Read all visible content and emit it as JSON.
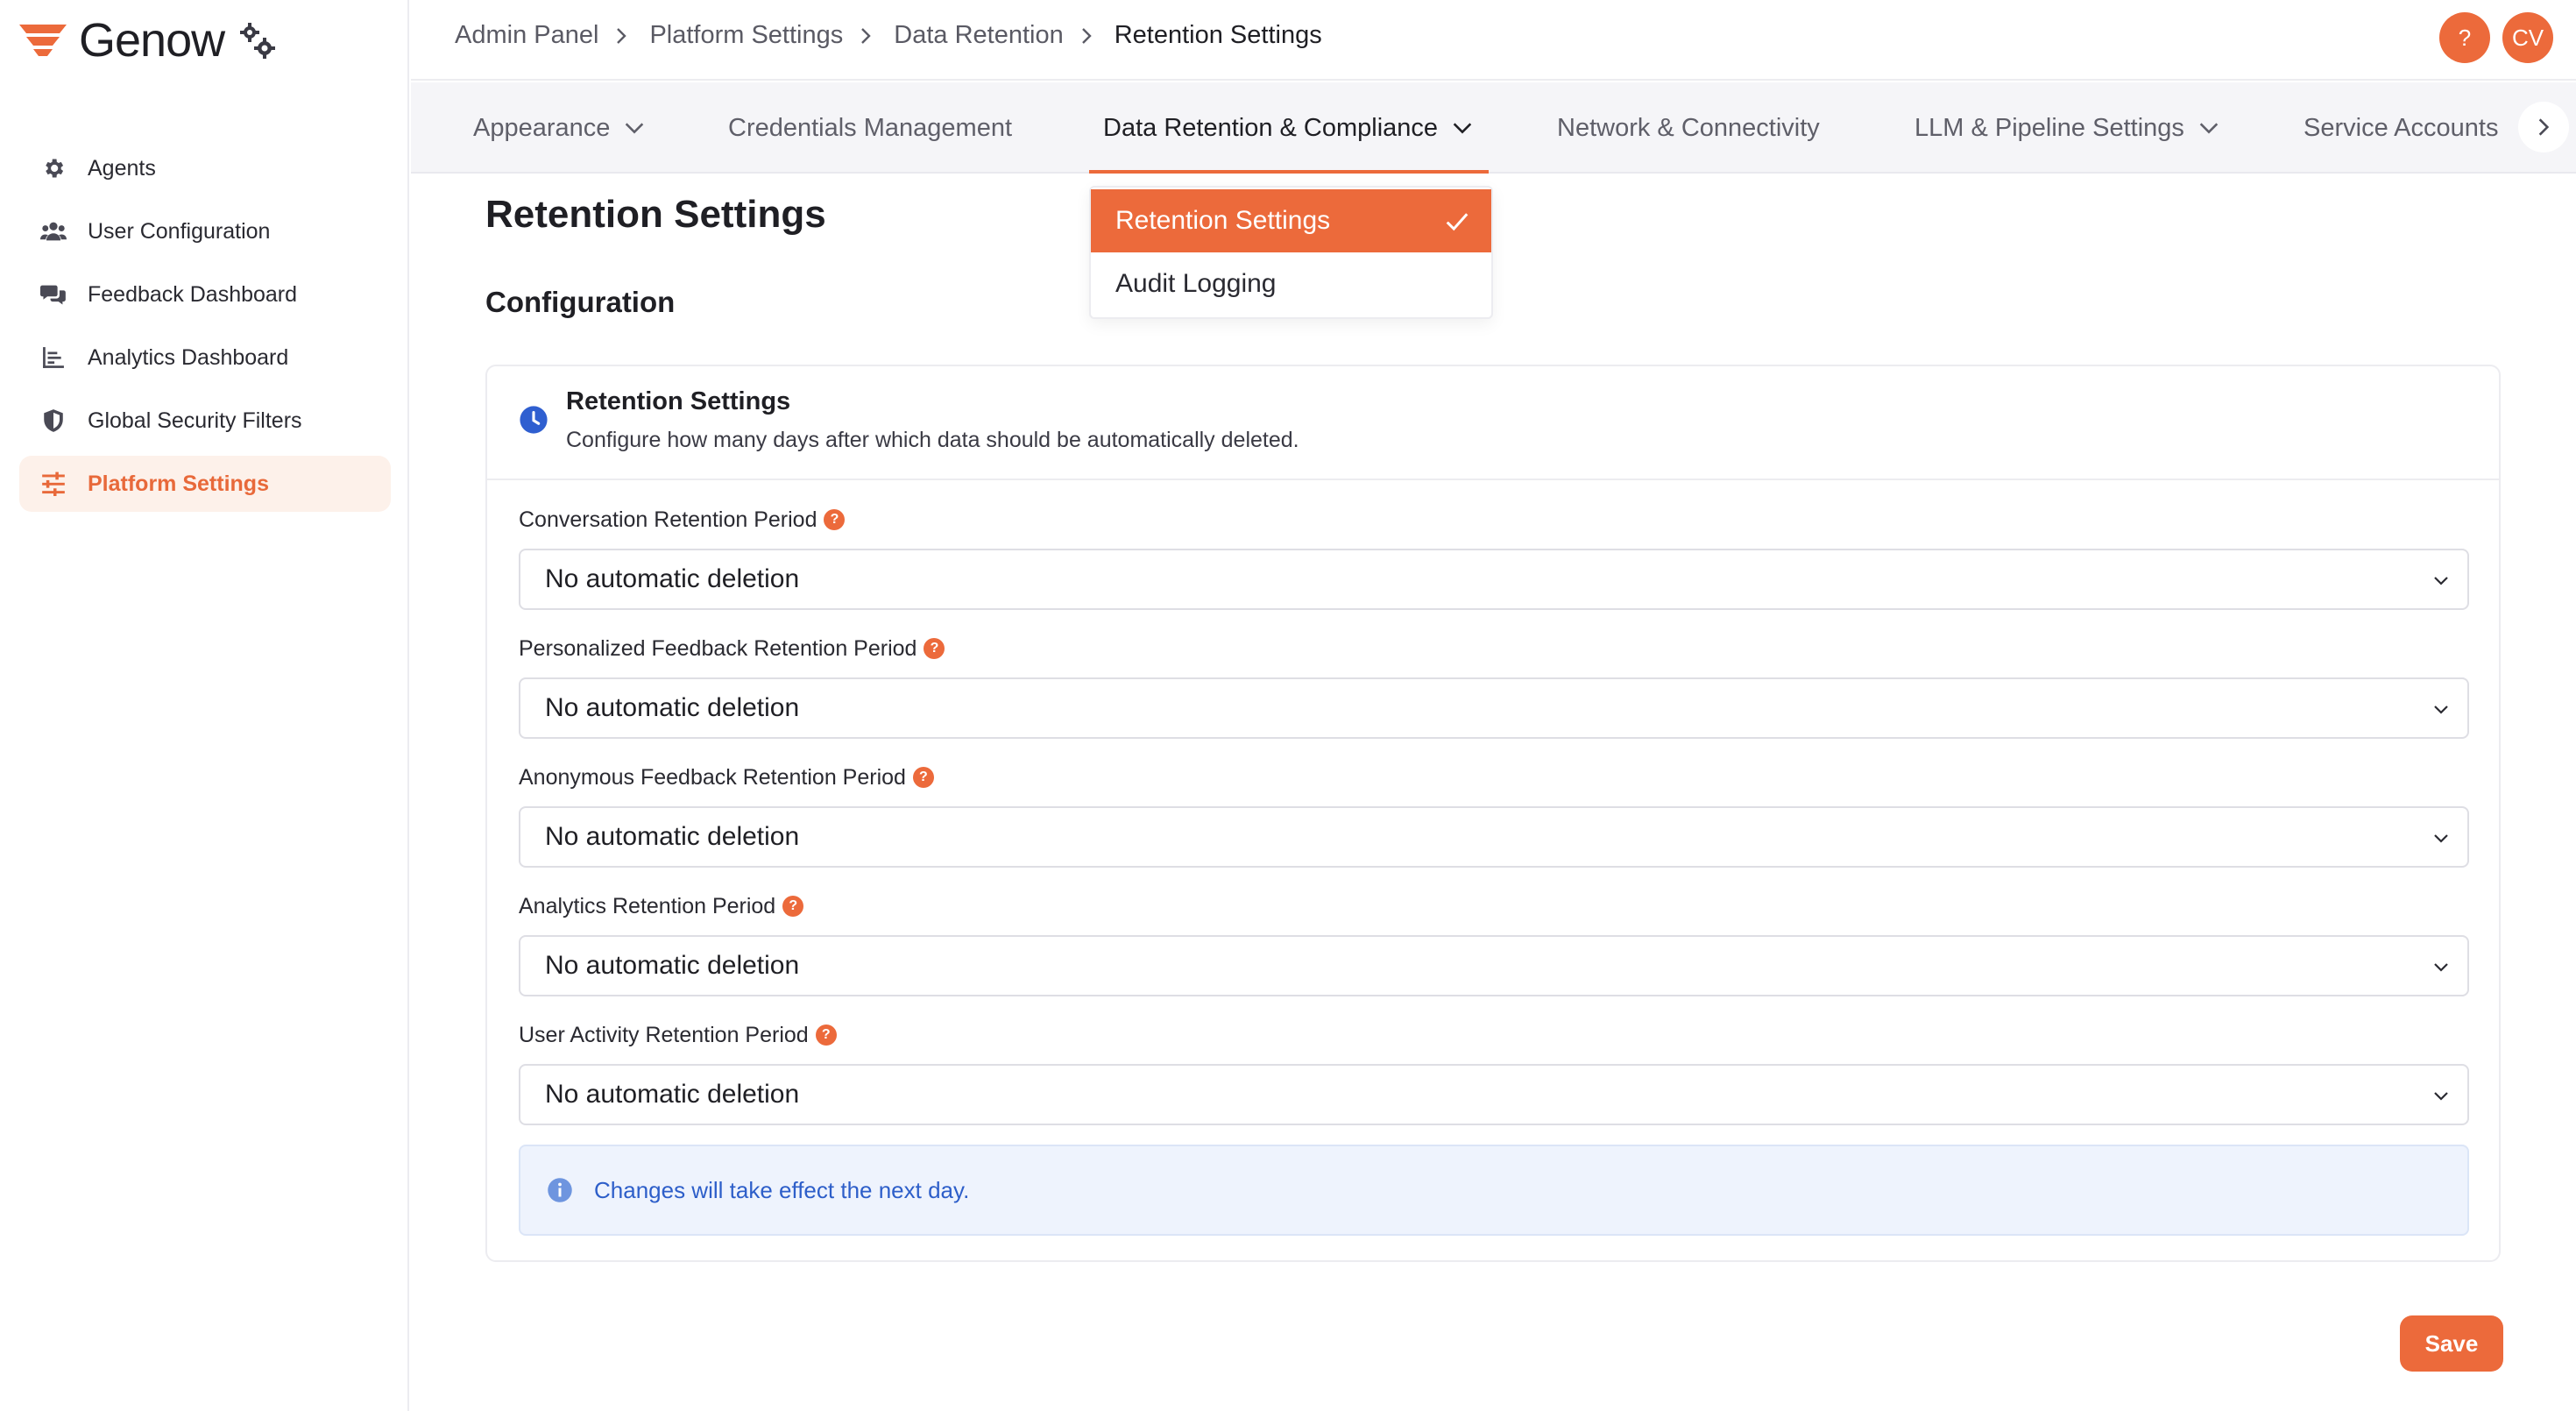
{
  "brand": {
    "name": "Genow",
    "accent": "#ec6a3b"
  },
  "sidebar": {
    "items": [
      {
        "label": "Agents",
        "icon": "gear-icon",
        "active": false
      },
      {
        "label": "User Configuration",
        "icon": "users-icon",
        "active": false
      },
      {
        "label": "Feedback Dashboard",
        "icon": "chat-bubbles-icon",
        "active": false
      },
      {
        "label": "Analytics Dashboard",
        "icon": "bar-chart-icon",
        "active": false
      },
      {
        "label": "Global Security Filters",
        "icon": "shield-icon",
        "active": false
      },
      {
        "label": "Platform Settings",
        "icon": "sliders-icon",
        "active": true
      }
    ]
  },
  "header": {
    "breadcrumb": [
      "Admin Panel",
      "Platform Settings",
      "Data Retention",
      "Retention Settings"
    ],
    "help_label": "?",
    "avatar_initials": "CV"
  },
  "tabs": [
    {
      "label": "Appearance",
      "has_dropdown": true
    },
    {
      "label": "Credentials Management",
      "has_dropdown": false
    },
    {
      "label": "Data Retention & Compliance",
      "has_dropdown": true,
      "active": true
    },
    {
      "label": "Network & Connectivity",
      "has_dropdown": false
    },
    {
      "label": "LLM & Pipeline Settings",
      "has_dropdown": true
    },
    {
      "label": "Service Accounts",
      "has_dropdown": false
    }
  ],
  "dropdown": {
    "items": [
      {
        "label": "Retention Settings",
        "selected": true
      },
      {
        "label": "Audit Logging",
        "selected": false
      }
    ]
  },
  "main": {
    "page_title": "Retention Settings",
    "section_title": "Configuration",
    "card": {
      "title": "Retention Settings",
      "description": "Configure how many days after which data should be automatically deleted.",
      "fields": [
        {
          "label": "Conversation Retention Period",
          "value": "No automatic deletion"
        },
        {
          "label": "Personalized Feedback Retention Period",
          "value": "No automatic deletion"
        },
        {
          "label": "Anonymous Feedback Retention Period",
          "value": "No automatic deletion"
        },
        {
          "label": "Analytics Retention Period",
          "value": "No automatic deletion"
        },
        {
          "label": "User Activity Retention Period",
          "value": "No automatic deletion"
        }
      ],
      "help_glyph": "?",
      "info_text": "Changes will take effect the next day."
    },
    "save_label": "Save"
  }
}
